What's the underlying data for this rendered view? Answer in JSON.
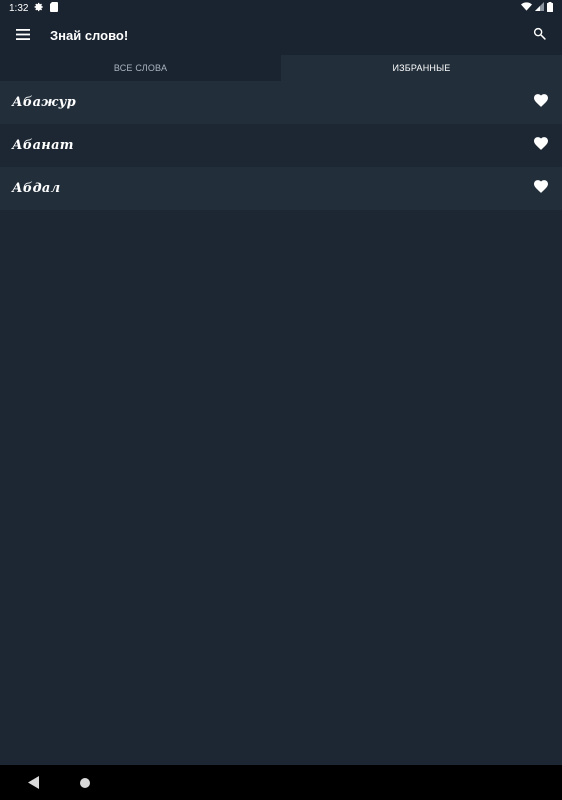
{
  "status_bar": {
    "time": "1:32",
    "icons": [
      "settings-icon",
      "sd-card-icon",
      "wifi-icon",
      "signal-icon",
      "battery-icon"
    ]
  },
  "app_bar": {
    "title": "Знай слово!",
    "icons": [
      "menu-icon",
      "search-icon"
    ]
  },
  "tabs": [
    {
      "label": "ВСЕ СЛОВА",
      "active": false
    },
    {
      "label": "ИЗБРАННЫЕ",
      "active": true
    }
  ],
  "favorites": [
    {
      "word": "Абажур",
      "icon": "heart-icon"
    },
    {
      "word": "Абанат",
      "icon": "heart-icon"
    },
    {
      "word": "Абдал",
      "icon": "heart-icon"
    }
  ],
  "nav_bar": {
    "icons": [
      "back-icon",
      "home-icon"
    ]
  },
  "colors": {
    "background": "#1c2733",
    "bar": "#1a2430",
    "row_alt": "#222f3b",
    "text": "#ffffff"
  }
}
